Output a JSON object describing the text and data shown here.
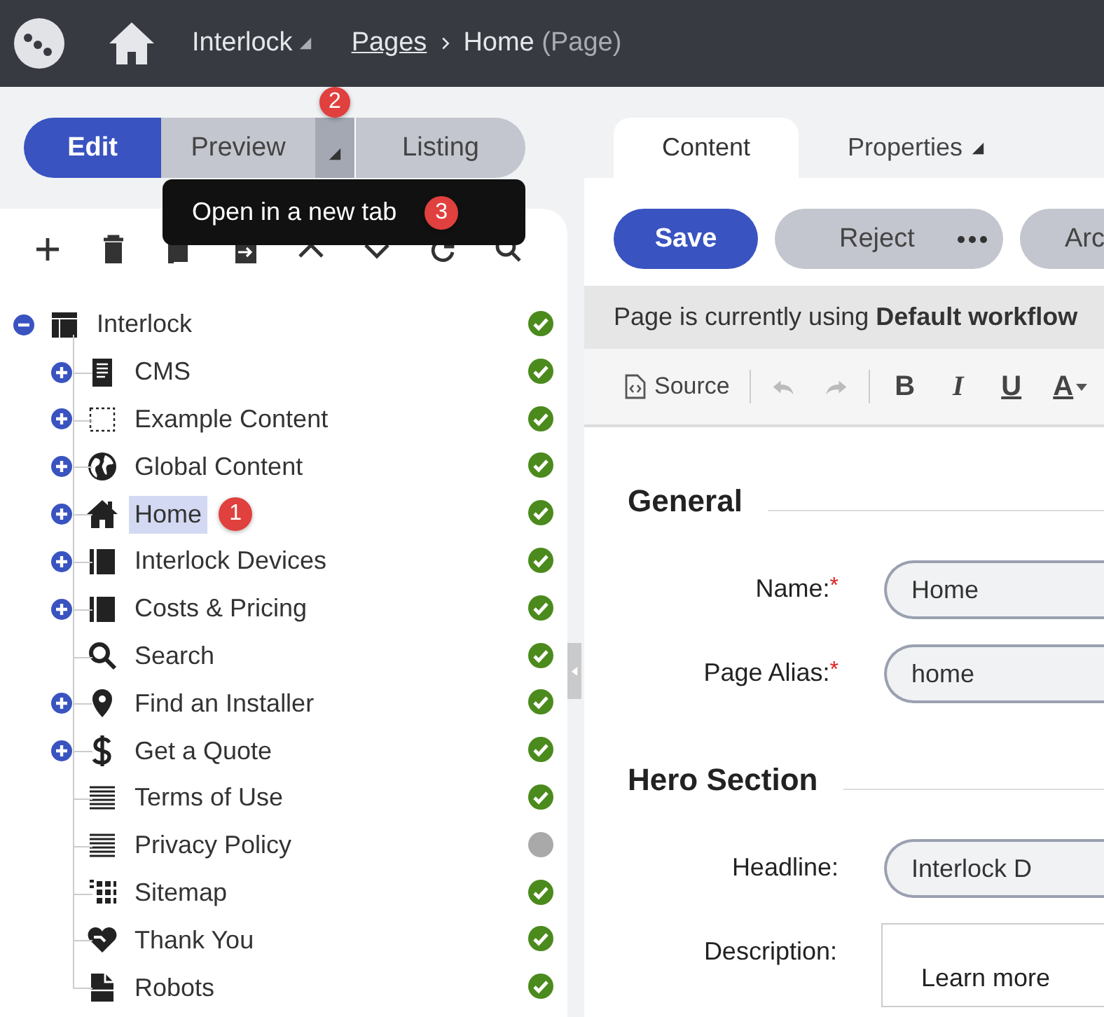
{
  "top_bar": {
    "site": "Interlock",
    "breadcrumb": [
      {
        "label": "Pages",
        "link": true
      },
      {
        "label": "Home",
        "link": false
      }
    ],
    "page_type": "(Page)"
  },
  "mode_buttons": [
    {
      "label": "Edit",
      "selected": true
    },
    {
      "label": "Preview",
      "selected": false,
      "has_menu": true,
      "badge": "2"
    },
    {
      "label": "Listing",
      "selected": false
    }
  ],
  "preview_menu": {
    "items": [
      {
        "label": "Open in a new tab",
        "badge": "3"
      }
    ]
  },
  "tree": {
    "label": "Interlock",
    "kind": "layout",
    "expanded": true,
    "selected": false,
    "published": true,
    "children": [
      {
        "label": "CMS",
        "kind": "document",
        "expanded": false,
        "selected": false,
        "published": true
      },
      {
        "label": "Example Content",
        "kind": "placeholder",
        "expanded": false,
        "selected": false,
        "published": true
      },
      {
        "label": "Global Content",
        "kind": "globe",
        "expanded": false,
        "selected": false,
        "published": true
      },
      {
        "label": "Home",
        "kind": "home",
        "expanded": false,
        "selected": true,
        "published": true,
        "badge": "1"
      },
      {
        "label": "Interlock Devices",
        "kind": "book",
        "expanded": false,
        "selected": false,
        "published": true
      },
      {
        "label": "Costs & Pricing",
        "kind": "book",
        "expanded": false,
        "selected": false,
        "published": true
      },
      {
        "label": "Search",
        "kind": "search",
        "selected": false,
        "published": true
      },
      {
        "label": "Find an Installer",
        "kind": "pin",
        "expanded": false,
        "selected": false,
        "published": true
      },
      {
        "label": "Get a Quote",
        "kind": "dollar",
        "expanded": false,
        "selected": false,
        "published": true
      },
      {
        "label": "Terms of Use",
        "kind": "lines",
        "selected": false,
        "published": true
      },
      {
        "label": "Privacy Policy",
        "kind": "lines",
        "selected": false,
        "published": false
      },
      {
        "label": "Sitemap",
        "kind": "grid",
        "selected": false,
        "published": true
      },
      {
        "label": "Thank You",
        "kind": "heart",
        "selected": false,
        "published": true
      },
      {
        "label": "Robots",
        "kind": "file",
        "selected": false,
        "published": true
      }
    ]
  },
  "tabs": [
    {
      "label": "Content",
      "selected": true
    },
    {
      "label": "Properties",
      "selected": false,
      "has_menu": true
    }
  ],
  "actions": [
    {
      "label": "Save",
      "kind": "primary"
    },
    {
      "label": "Reject",
      "kind": "secondary",
      "has_more": true
    },
    {
      "label": "Arc",
      "kind": "secondary"
    }
  ],
  "workflow_notice": "Page is currently using **Default workflow**",
  "editor_toolbar": [
    {
      "kind": "source",
      "label": "Source"
    },
    {
      "kind": "undo",
      "disabled": true
    },
    {
      "kind": "redo",
      "disabled": true
    },
    {
      "kind": "bold",
      "label": "B"
    },
    {
      "kind": "italic",
      "label": "I"
    },
    {
      "kind": "underline",
      "label": "U"
    },
    {
      "kind": "color",
      "label": "A"
    }
  ],
  "sections": [
    {
      "title": "General",
      "fields": [
        {
          "label": "Name:",
          "required_mark": "*",
          "kind": "text",
          "value": "Home"
        },
        {
          "label": "Page Alias:",
          "required_mark": "*",
          "kind": "text",
          "value": "home"
        }
      ]
    },
    {
      "title": "Hero Section",
      "fields": [
        {
          "label": "Headline:",
          "kind": "text",
          "value": "Interlock D"
        },
        {
          "label": "Description:",
          "kind": "richtext",
          "value": "Learn more"
        }
      ]
    }
  ]
}
